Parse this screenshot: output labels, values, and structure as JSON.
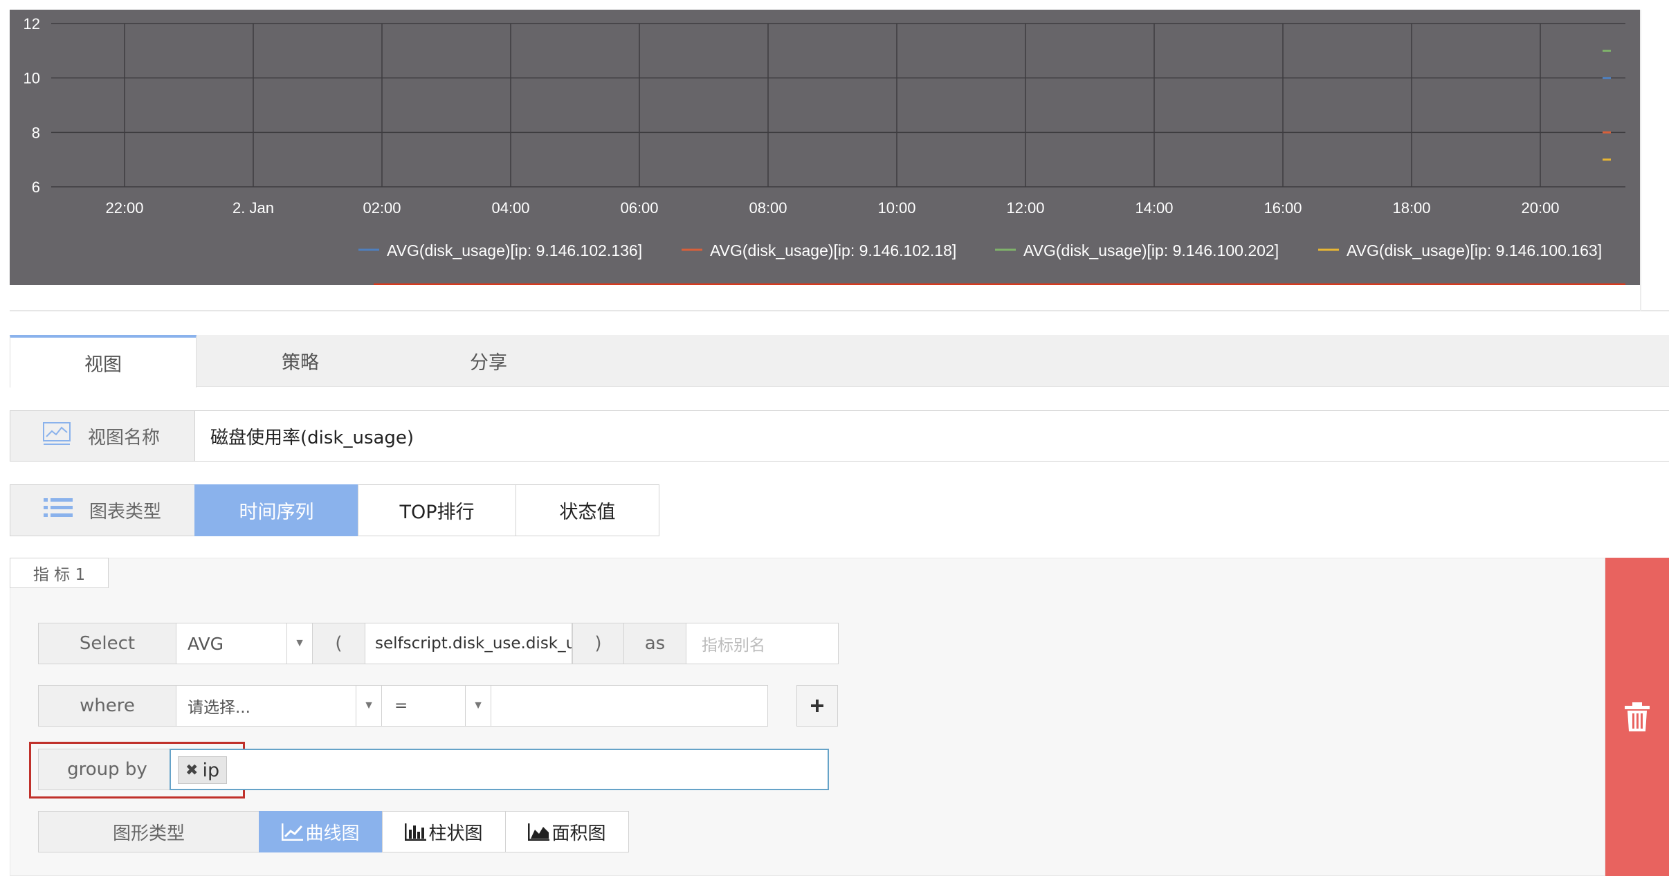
{
  "chart_data": {
    "type": "line",
    "title": "",
    "xlabel": "",
    "ylabel": "",
    "ylim": [
      6,
      12
    ],
    "y_ticks": [
      "12",
      "10",
      "8",
      "6"
    ],
    "x_ticks": [
      "22:00",
      "2. Jan",
      "02:00",
      "04:00",
      "06:00",
      "08:00",
      "10:00",
      "12:00",
      "14:00",
      "16:00",
      "18:00",
      "20:00"
    ],
    "grid": true,
    "background": "#676569",
    "legend_position": "bottom",
    "series": [
      {
        "name": "AVG(disk_usage)[ip: 9.146.102.136]",
        "color": "#4f7fbd",
        "last_value": 10
      },
      {
        "name": "AVG(disk_usage)[ip: 9.146.102.18]",
        "color": "#d8603a",
        "last_value": 8
      },
      {
        "name": "AVG(disk_usage)[ip: 9.146.100.202]",
        "color": "#7fb26a",
        "last_value": 11
      },
      {
        "name": "AVG(disk_usage)[ip: 9.146.100.163]",
        "color": "#e8b634",
        "last_value": 7
      }
    ]
  },
  "tabs": [
    {
      "label": "视图",
      "active": true
    },
    {
      "label": "策略",
      "active": false
    },
    {
      "label": "分享",
      "active": false
    }
  ],
  "view_name": {
    "label": "视图名称",
    "value": "磁盘使用率(disk_usage)",
    "icon": "image-icon"
  },
  "chart_type": {
    "label": "图表类型",
    "icon": "list-icon",
    "options": [
      {
        "label": "时间序列",
        "active": true
      },
      {
        "label": "TOP排行",
        "active": false
      },
      {
        "label": "状态值",
        "active": false
      }
    ]
  },
  "metric": {
    "title": "指 标 1",
    "select": {
      "label": "Select",
      "aggregation": "AVG",
      "open_paren": "(",
      "metric_value": "selfscript.disk_use.disk_usage",
      "close_paren": ")",
      "as_label": "as",
      "alias_placeholder": "指标别名"
    },
    "where": {
      "label": "where",
      "field_placeholder": "请选择...",
      "operator": "=",
      "value": "",
      "add_icon": "plus-icon"
    },
    "group_by": {
      "label": "group by",
      "tags": [
        "ip"
      ],
      "remove_icon": "close-icon"
    },
    "graph_type": {
      "label": "图形类型",
      "options": [
        {
          "label": "曲线图",
          "icon": "line-chart-icon",
          "active": true
        },
        {
          "label": "柱状图",
          "icon": "bar-chart-icon",
          "active": false
        },
        {
          "label": "面积图",
          "icon": "area-chart-icon",
          "active": false
        }
      ]
    },
    "delete_icon": "trash-icon"
  },
  "colors": {
    "accent": "#8ab2ec",
    "danger": "#e8635f",
    "highlight_border": "#c0312b"
  }
}
